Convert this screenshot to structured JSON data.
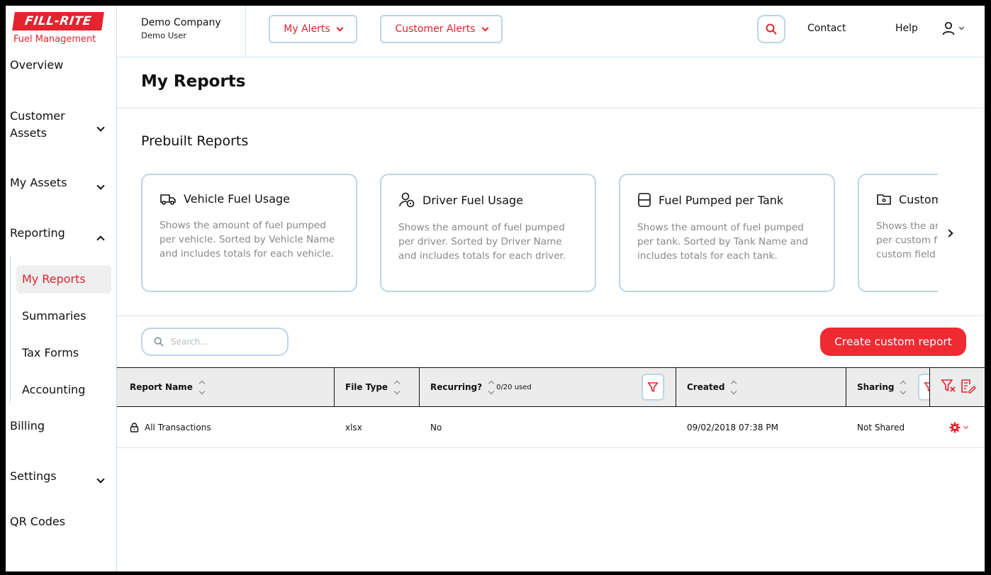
{
  "brand": {
    "logo_top": "FILL-RITE",
    "logo_bottom": "Fuel Management",
    "red": "#e3232e"
  },
  "header": {
    "company": "Demo Company",
    "user": "Demo User",
    "my_alerts": "My Alerts",
    "customer_alerts": "Customer Alerts",
    "contact": "Contact",
    "help": "Help"
  },
  "sidebar": {
    "overview": "Overview",
    "customer_assets_1": "Customer",
    "customer_assets_2": "Assets",
    "my_assets": "My Assets",
    "reporting": "Reporting",
    "my_reports": "My Reports",
    "summaries": "Summaries",
    "tax_forms": "Tax Forms",
    "accounting": "Accounting",
    "billing": "Billing",
    "settings": "Settings",
    "qr_codes": "QR Codes"
  },
  "main": {
    "title": "My Reports",
    "prebuilt_title": "Prebuilt Reports",
    "cards": [
      {
        "title": "Vehicle Fuel Usage",
        "icon": "truck-icon",
        "desc": "Shows the amount of fuel pumped per vehicle. Sorted by Vehicle Name and includes totals for each vehicle."
      },
      {
        "title": "Driver Fuel Usage",
        "icon": "driver-icon",
        "desc": "Shows the amount of fuel pumped per driver. Sorted by Driver Name and includes totals for each driver."
      },
      {
        "title": "Fuel Pumped per Tank",
        "icon": "tank-icon",
        "desc": "Shows the amount of fuel pumped per tank. Sorted by Tank Name and includes totals for each tank."
      },
      {
        "title": "Custom",
        "icon": "folder-icon",
        "desc": "Shows the amount of fuel pumped per custom field. Sorted by the custom field and includes totals"
      }
    ],
    "search_placeholder": "Search...",
    "create_button": "Create custom report"
  },
  "table": {
    "columns": {
      "report_name": "Report Name",
      "file_type": "File Type",
      "recurring": "Recurring?",
      "recurring_used": "0/20 used",
      "created": "Created",
      "sharing": "Sharing"
    },
    "rows": [
      {
        "name": "All Transactions",
        "file_type": "xlsx",
        "recurring": "No",
        "created": "09/02/2018 07:38 PM",
        "sharing": "Not Shared"
      }
    ]
  }
}
